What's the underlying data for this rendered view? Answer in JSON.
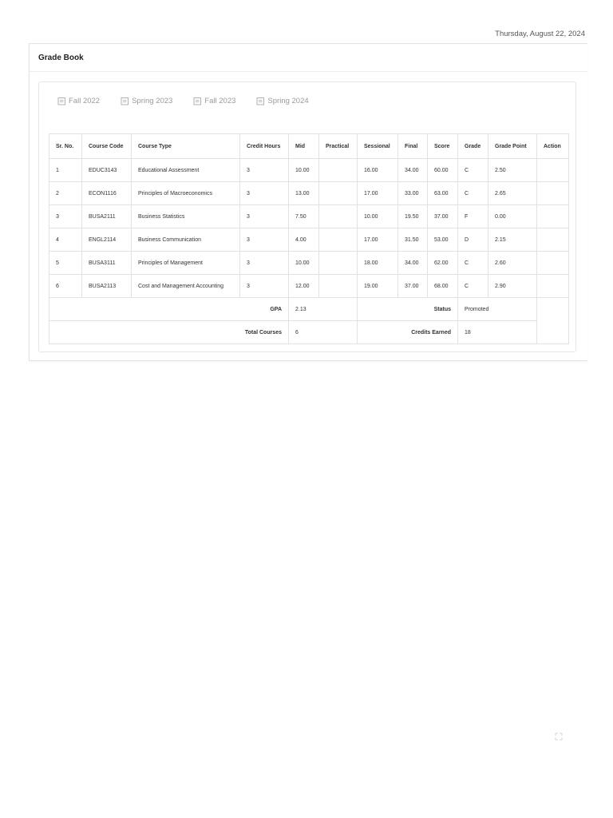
{
  "header": {
    "date": "Thursday, August 22, 2024"
  },
  "card": {
    "title": "Grade Book"
  },
  "tabs": [
    {
      "label": "Fall 2022"
    },
    {
      "label": "Spring 2023"
    },
    {
      "label": "Fall 2023"
    },
    {
      "label": "Spring 2024"
    }
  ],
  "table": {
    "headers": [
      "Sr. No.",
      "Course Code",
      "Course Type",
      "Credit Hours",
      "Mid",
      "Practical",
      "Sessional",
      "Final",
      "Score",
      "Grade",
      "Grade Point",
      "Action"
    ],
    "rows": [
      [
        "1",
        "EDUC3143",
        "Educational Assessment",
        "3",
        "10.00",
        "",
        "16.00",
        "34.00",
        "60.00",
        "C",
        "2.50",
        ""
      ],
      [
        "2",
        "ECON1116",
        "Principles of Macroeconomics",
        "3",
        "13.00",
        "",
        "17.00",
        "33.00",
        "63.00",
        "C",
        "2.65",
        ""
      ],
      [
        "3",
        "BUSA2111",
        "Business Statistics",
        "3",
        "7.50",
        "",
        "10.00",
        "19.50",
        "37.00",
        "F",
        "0.00",
        ""
      ],
      [
        "4",
        "ENGL2114",
        "Business Communication",
        "3",
        "4.00",
        "",
        "17.00",
        "31.50",
        "53.00",
        "D",
        "2.15",
        ""
      ],
      [
        "5",
        "BUSA3111",
        "Principles of Management",
        "3",
        "10.00",
        "",
        "18.00",
        "34.00",
        "62.00",
        "C",
        "2.60",
        ""
      ],
      [
        "6",
        "BUSA2113",
        "Cost and Management Accounting",
        "3",
        "12.00",
        "",
        "19.00",
        "37.00",
        "68.00",
        "C",
        "2.90",
        ""
      ]
    ],
    "summary": {
      "gpa_label": "GPA",
      "gpa_value": "2.13",
      "status_label": "Status",
      "status_value": "Promoted",
      "total_courses_label": "Total Courses",
      "total_courses_value": "6",
      "credits_earned_label": "Credits Earned",
      "credits_earned_value": "18"
    }
  },
  "icons": {
    "tab_icon": "calendar-icon",
    "corner_icon": "expand-icon"
  }
}
